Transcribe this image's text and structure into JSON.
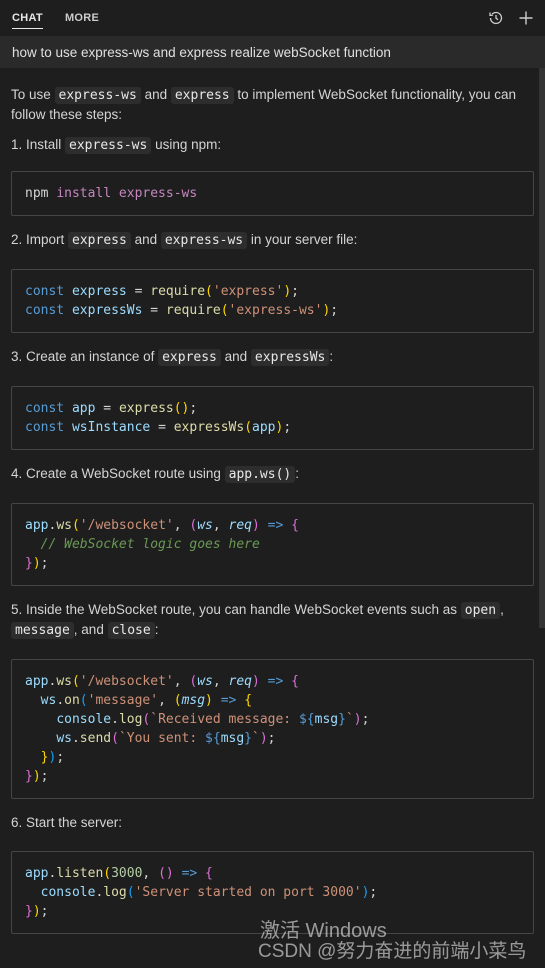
{
  "header": {
    "tabs": [
      {
        "label": "CHAT"
      },
      {
        "label": "MORE"
      }
    ],
    "actions": [
      "history-icon",
      "plus-icon"
    ]
  },
  "question": "how to use express-ws and express realize webSocket function",
  "intro": {
    "text1": "To use ",
    "code1": "express-ws",
    "text2": " and ",
    "code2": "express",
    "text3": " to implement WebSocket functionality, you can follow these steps:"
  },
  "steps": [
    {
      "pre": "1. Install ",
      "code": "express-ws",
      "post": " using npm:"
    },
    {
      "pre": "2. Import ",
      "code": "express",
      "mid": " and ",
      "code2": "express-ws",
      "post": " in your server file:"
    },
    {
      "pre": "3. Create an instance of ",
      "code": "express",
      "mid": " and ",
      "code2": "expressWs",
      "post": ":"
    },
    {
      "pre": "4. Create a WebSocket route using ",
      "code": "app.ws()",
      "post": ":"
    },
    {
      "pre": "5. Inside the WebSocket route, you can handle WebSocket events such as ",
      "code": "open",
      "mid": ",",
      "code2": "message",
      "mid2": ", and ",
      "code3": "close",
      "post": ":"
    },
    {
      "pre": "6. Start the server:"
    }
  ],
  "code": {
    "npm": "npm install express-ws",
    "import": [
      "const express = require('express');",
      "const expressWs = require('express-ws');"
    ],
    "instance": [
      "const app = express();",
      "const wsInstance = expressWs(app);"
    ],
    "route": [
      "app.ws('/websocket', (ws, req) => {",
      "  // WebSocket logic goes here",
      "});"
    ],
    "events": [
      "app.ws('/websocket', (ws, req) => {",
      "  ws.on('message', (msg) => {",
      "    console.log(`Received message: ${msg}`);",
      "    ws.send(`You sent: ${msg}`);",
      "  });",
      "});"
    ],
    "listen": [
      "app.listen(3000, () => {",
      "  console.log('Server started on port 3000');",
      "});"
    ]
  },
  "watermark": {
    "activate": "激活 Windows",
    "csdn": "CSDN @努力奋进的前端小菜鸟"
  },
  "colors": {
    "keyword": "#569cd6",
    "variable": "#9cdcfe",
    "function": "#dcdcaa",
    "string": "#ce9178",
    "comment": "#6a9955"
  }
}
